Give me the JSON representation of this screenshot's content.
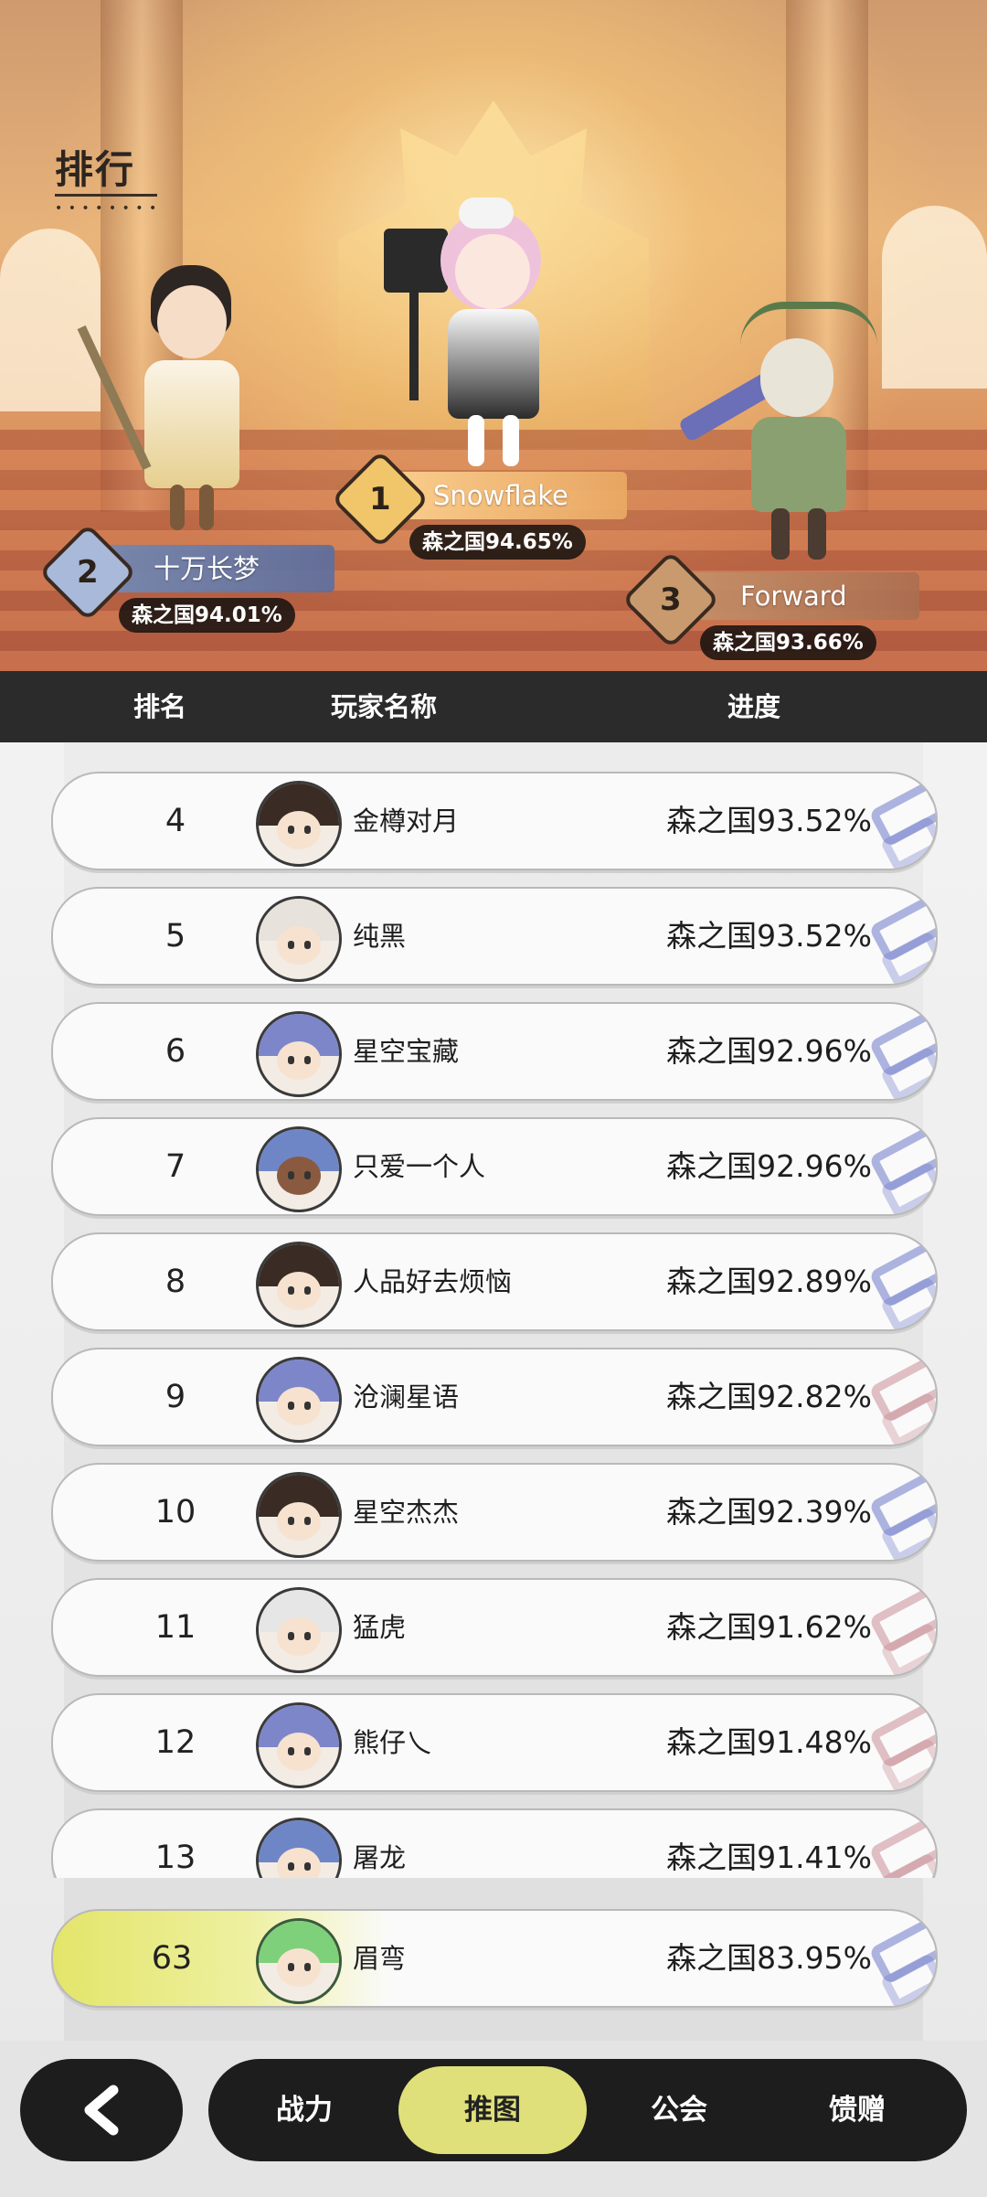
{
  "page": {
    "title": "排行"
  },
  "podium": [
    {
      "rank": "1",
      "name": "Snowflake",
      "progress": "森之国94.65%"
    },
    {
      "rank": "2",
      "name": "十万长梦",
      "progress": "森之国94.01%"
    },
    {
      "rank": "3",
      "name": "Forward",
      "progress": "森之国93.66%"
    }
  ],
  "table": {
    "headers": {
      "rank": "排名",
      "player": "玩家名称",
      "progress": "进度"
    },
    "rows": [
      {
        "rank": "4",
        "name": "金樽对月",
        "progress": "森之国93.52%"
      },
      {
        "rank": "5",
        "name": "纯黑",
        "progress": "森之国93.52%"
      },
      {
        "rank": "6",
        "name": "星空宝藏",
        "progress": "森之国92.96%"
      },
      {
        "rank": "7",
        "name": "只爱一个人",
        "progress": "森之国92.96%"
      },
      {
        "rank": "8",
        "name": "人品好去烦恼",
        "progress": "森之国92.89%"
      },
      {
        "rank": "9",
        "name": "沧澜星语",
        "progress": "森之国92.82%"
      },
      {
        "rank": "10",
        "name": "星空杰杰",
        "progress": "森之国92.39%"
      },
      {
        "rank": "11",
        "name": "猛虎",
        "progress": "森之国91.62%"
      },
      {
        "rank": "12",
        "name": "熊仔乀",
        "progress": "森之国91.48%"
      },
      {
        "rank": "13",
        "name": "屠龙",
        "progress": "森之国91.41%"
      }
    ],
    "self": {
      "rank": "63",
      "name": "眉弯",
      "progress": "森之国83.95%"
    }
  },
  "nav": {
    "back_icon": "chevron-left-icon",
    "tabs": [
      "战力",
      "推图",
      "公会",
      "馈赠"
    ],
    "active_tab": "推图"
  },
  "colors": {
    "header_bg": "#2b2b2b",
    "nav_bg": "#1d1d1d",
    "accent": "#dfe07a",
    "self_highlight": "#e3e56a"
  }
}
